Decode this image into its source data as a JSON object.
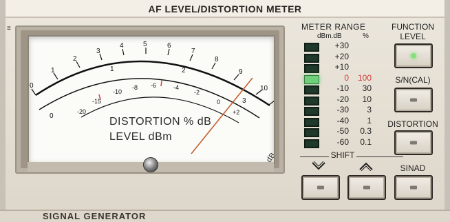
{
  "header": {
    "title": "AF LEVEL/DISTORTION METER"
  },
  "left_glyph": "≡",
  "meter": {
    "distortion_label": "DISTORTION  %  dB",
    "level_label": "LEVEL   dBm",
    "db_label": "dB",
    "dbm_label": "dBm",
    "scale_top": [
      "0",
      "1",
      "2",
      "3",
      "4",
      "5",
      "6",
      "7",
      "8",
      "9",
      "10"
    ],
    "scale_mid": [
      "0",
      "1",
      "2",
      "3"
    ],
    "scale_low": [
      "-20",
      "-15",
      "-10",
      "-8",
      "-6",
      "-4",
      "-2",
      "0",
      "+2"
    ],
    "pointer_value": 0.78
  },
  "meter_range": {
    "title": "METER RANGE",
    "head_db": "dBm.dB",
    "head_pct": "%",
    "rows": [
      {
        "db": "+30",
        "pct": ""
      },
      {
        "db": "+20",
        "pct": ""
      },
      {
        "db": "+10",
        "pct": ""
      },
      {
        "db": "0",
        "pct": "100"
      },
      {
        "db": "-10",
        "pct": "30"
      },
      {
        "db": "-20",
        "pct": "10"
      },
      {
        "db": "-30",
        "pct": "3"
      },
      {
        "db": "-40",
        "pct": "1"
      },
      {
        "db": "-50",
        "pct": "0.3"
      },
      {
        "db": "-60",
        "pct": "0.1"
      }
    ],
    "active_row": 3,
    "active_color": "#d4403a"
  },
  "controls": {
    "function_level_label": "FUNCTION\nLEVEL",
    "sn_cal_label": "S/N(CAL)",
    "distortion_label": "DISTORTION",
    "sinad_label": "SINAD",
    "shift_label": "SHIFT"
  },
  "footer": {
    "title": "SIGNAL  GENERATOR"
  }
}
